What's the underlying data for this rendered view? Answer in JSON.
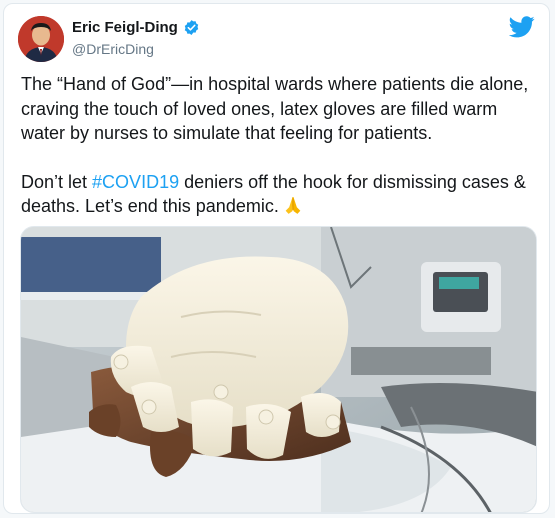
{
  "author": {
    "display_name": "Eric Feigl-Ding",
    "handle": "@DrEricDing",
    "avatar_icon": "avatar-portrait",
    "verified_icon": "verified-badge-icon"
  },
  "brand": {
    "logo_icon": "twitter-bird-icon",
    "color": "#1da1f2"
  },
  "tweet": {
    "paragraph1": "The “Hand of God”—in hospital wards where patients die alone, craving the touch of loved ones, latex gloves are filled warm water by nurses to simulate that feeling for patients.",
    "paragraph2_before": "Don’t let ",
    "hashtag": "#COVID19",
    "paragraph2_after": " deniers off the hook for dismissing cases & deaths. Let’s end this pandemic.",
    "emoji_icon": "folded-hands-emoji-icon"
  },
  "media": {
    "kind": "photo",
    "subject": "water-filled-glove-holding-patient-hand"
  },
  "colors": {
    "text": "#14171a",
    "secondary": "#657786",
    "link": "#1da1f2",
    "border": "#e1e8ed"
  }
}
